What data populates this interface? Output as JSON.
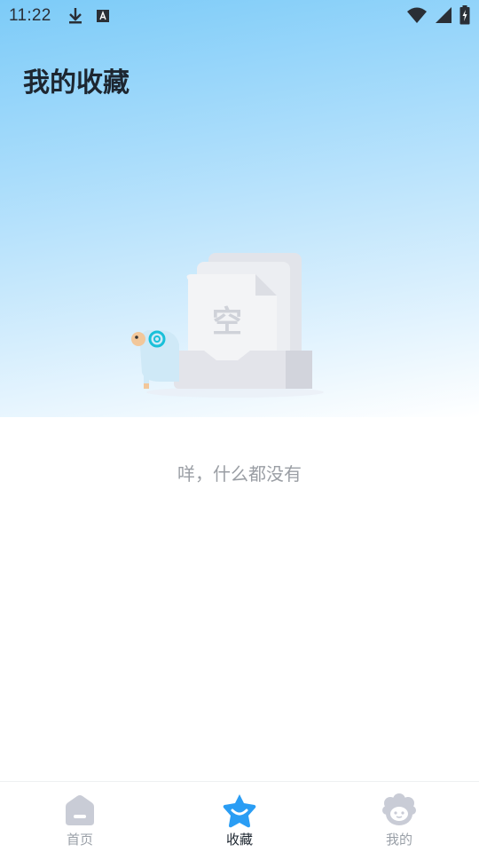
{
  "status_bar": {
    "time": "11:22",
    "icons": [
      "download-icon",
      "keyboard-a-icon",
      "wifi-icon",
      "signal-icon",
      "battery-charging-icon"
    ]
  },
  "page": {
    "title": "我的收藏"
  },
  "empty_state": {
    "illustration_text": "空",
    "message": "咩，什么都没有"
  },
  "tabbar": {
    "items": [
      {
        "label": "首页",
        "icon": "home-icon",
        "active": false
      },
      {
        "label": "收藏",
        "icon": "star-icon",
        "active": true
      },
      {
        "label": "我的",
        "icon": "profile-sheep-icon",
        "active": false
      }
    ]
  },
  "colors": {
    "accent": "#2a9df4",
    "inactive_icon": "#c9ccd6",
    "title_text": "#1d2630",
    "muted_text": "#9a9ea4"
  }
}
